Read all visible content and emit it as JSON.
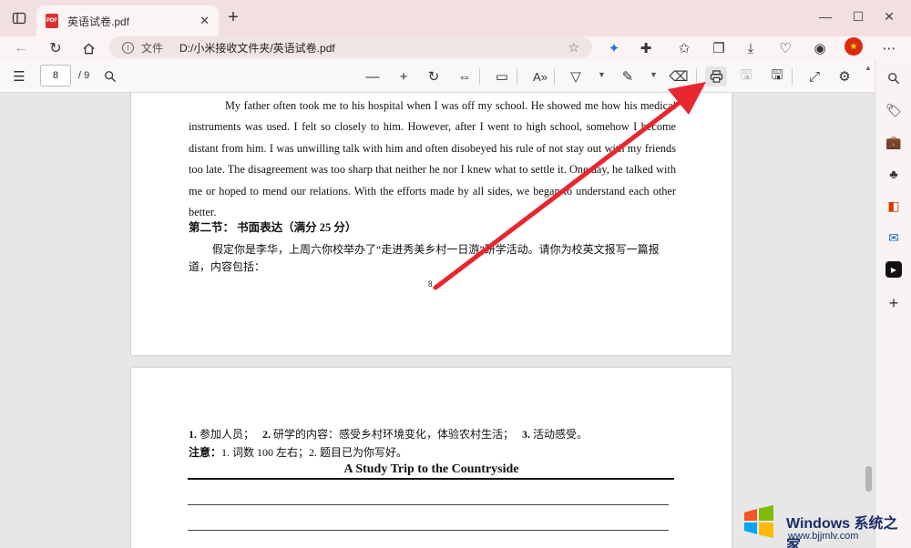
{
  "tab": {
    "title": "英语试卷.pdf",
    "icon": "pdf-icon"
  },
  "address": {
    "site_label": "文件",
    "url": "D:/小米接收文件夹/英语试卷.pdf"
  },
  "pdf_toolbar": {
    "current_page": "8",
    "total_pages": "/ 9"
  },
  "page1": {
    "paragraph": "My father often took me to his hospital when I was off my school. He showed me how his medical instruments was used. I felt so closely to him. However, after I went to high school, somehow I become distant from him. I was unwilling talk with him and often disobeyed his rule of not stay out with my friends too late. The disagreement was too sharp that neither he nor I knew what to settle it. One day, he talked with me or hoped to mend our relations. With the efforts made by all sides, we began to understand each other better.",
    "section_heading": "第二节： 书面表达（满分 25 分）",
    "task_text": "假定你是李华，上周六你校举办了“走进秀美乡村一日游”研学活动。请你为校英文报写一篇报道，内容包括：",
    "page_number": "8"
  },
  "page2": {
    "req_1_num": "1.",
    "req_1_text": " 参加人员；",
    "req_2_num": "2.",
    "req_2_text": " 研学的内容：感受乡村环境变化，体验农村生活；",
    "req_3_num": "3.",
    "req_3_text": " 活动感受。",
    "note_label": "注意：",
    "note_text": "1. 词数 100 左右；2. 题目已为你写好。",
    "essay_title": "A Study Trip to the Countryside"
  },
  "watermark": {
    "title": "Windows 系统之家",
    "url": "www.bjjmlv.com"
  },
  "colors": {
    "tab_bar": "#f2dfdf",
    "arrow": "#e8262d",
    "flag": "#de2910"
  }
}
